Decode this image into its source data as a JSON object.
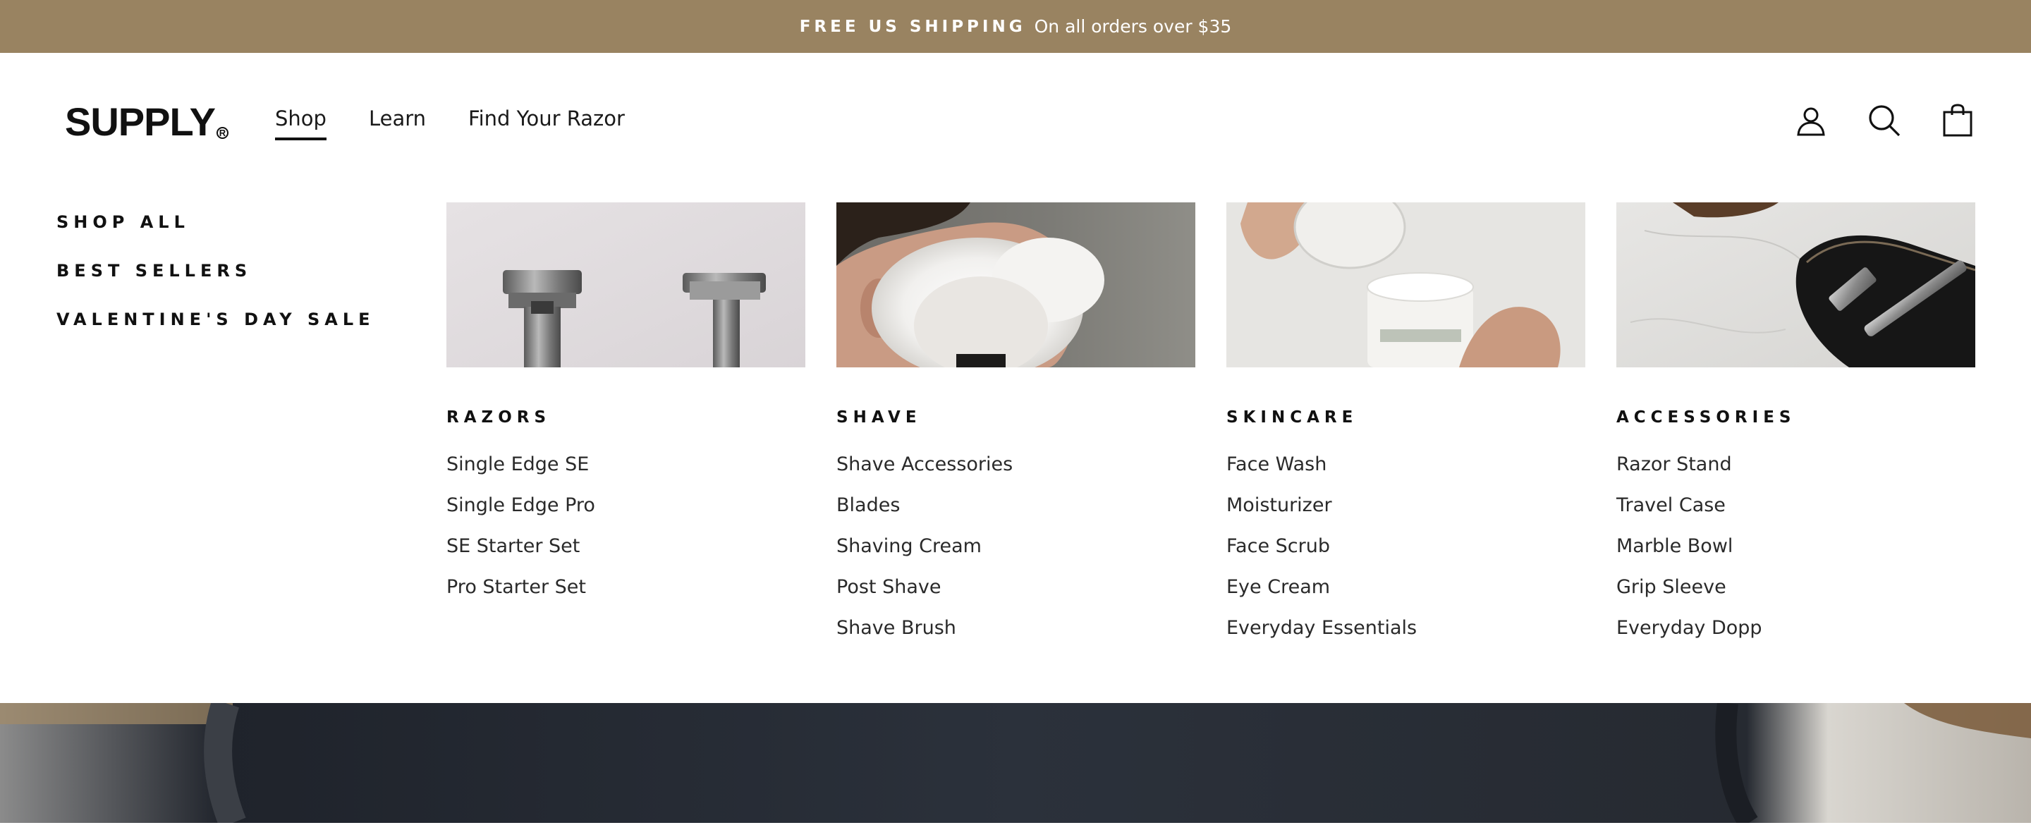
{
  "announcement": {
    "strong": "FREE US SHIPPING",
    "text": "On all orders over $35"
  },
  "brand": {
    "name": "SUPPLY",
    "reg_mark": "R"
  },
  "nav": [
    {
      "label": "Shop",
      "active": true
    },
    {
      "label": "Learn",
      "active": false
    },
    {
      "label": "Find Your Razor",
      "active": false
    }
  ],
  "header_icons": [
    "account-icon",
    "search-icon",
    "cart-icon"
  ],
  "menu": {
    "side_links": [
      "SHOP ALL",
      "BEST SELLERS",
      "VALENTINE'S DAY SALE"
    ],
    "columns": [
      {
        "title": "RAZORS",
        "image": "razors-image",
        "links": [
          "Single Edge SE",
          "Single Edge Pro",
          "SE Starter Set",
          "Pro Starter Set"
        ]
      },
      {
        "title": "SHAVE",
        "image": "shave-image",
        "links": [
          "Shave Accessories",
          "Blades",
          "Shaving Cream",
          "Post Shave",
          "Shave Brush"
        ]
      },
      {
        "title": "SKINCARE",
        "image": "skincare-image",
        "links": [
          "Face Wash",
          "Moisturizer",
          "Face Scrub",
          "Eye Cream",
          "Everyday Essentials"
        ]
      },
      {
        "title": "ACCESSORIES",
        "image": "accessories-image",
        "links": [
          "Razor Stand",
          "Travel Case",
          "Marble Bowl",
          "Grip Sleeve",
          "Everyday Dopp"
        ]
      }
    ]
  },
  "colors": {
    "announcement_bg": "#998361",
    "text": "#1a1a1a",
    "hero_bg": "#2a2f38"
  }
}
